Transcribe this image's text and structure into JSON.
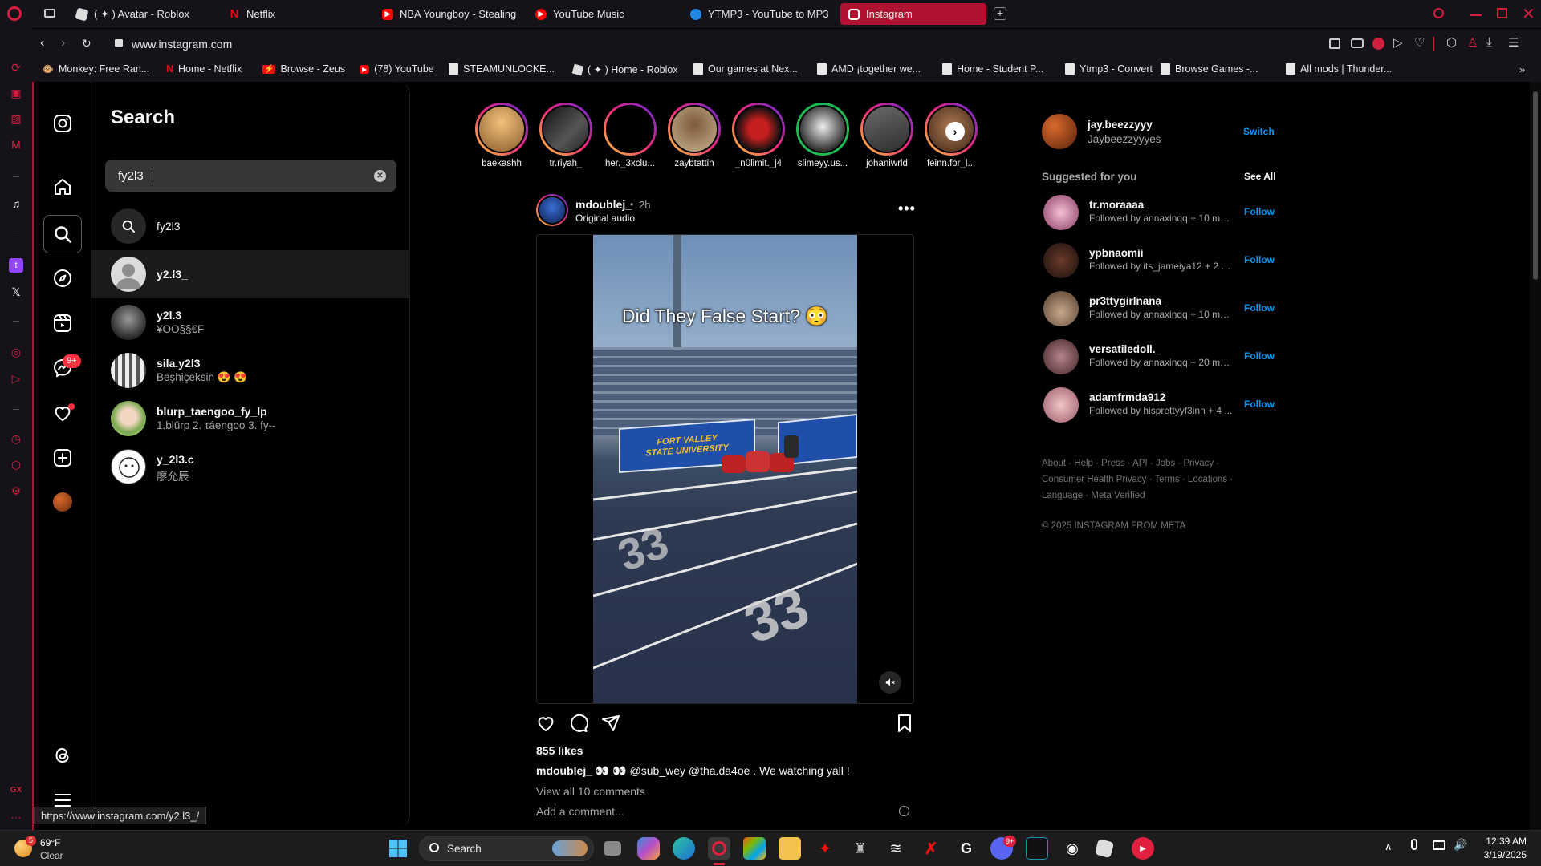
{
  "browser": {
    "tabs": [
      {
        "label": "( ✦ ) Avatar - Roblox",
        "favicon": "roblox-icon"
      },
      {
        "label": "Netflix",
        "favicon": "netflix-icon"
      },
      {
        "label": "NBA Youngboy - Stealing",
        "favicon": "youtube-icon"
      },
      {
        "label": "YouTube Music",
        "favicon": "youtube-music-icon"
      },
      {
        "label": "YTMP3 - YouTube to MP3",
        "favicon": "ytmp3-icon"
      },
      {
        "label": "Instagram",
        "favicon": "instagram-icon",
        "active": true
      }
    ],
    "url": "www.instagram.com",
    "bookmarks": [
      "Monkey: Free Ran...",
      "Home - Netflix",
      "Browse - Zeus",
      "(78) YouTube",
      "STEAMUNLOCKE...",
      "( ✦ ) Home - Roblox",
      "Our games at Nex...",
      "AMD ¡together we...",
      "Home - Student P...",
      "Ytmp3 - Convert",
      "Browse Games -...",
      "All mods | Thunder..."
    ],
    "status_url": "https://www.instagram.com/y2.l3_/",
    "accent": "#b01231"
  },
  "search_panel": {
    "title": "Search",
    "query": "fy2l3",
    "results": [
      {
        "type": "query",
        "title": "fy2l3",
        "subtitle": ""
      },
      {
        "type": "user",
        "title": "y2.l3_",
        "subtitle": ""
      },
      {
        "type": "user",
        "title": "y2l.3",
        "subtitle": "¥OO§§€F"
      },
      {
        "type": "user",
        "title": "sila.y2l3",
        "subtitle": "Beşhiçeksin 😍 😍"
      },
      {
        "type": "user",
        "title": "blurp_taengoo_fy_lp",
        "subtitle": "1.blürp 2. τáengoo 3. fy--"
      },
      {
        "type": "user",
        "title": "y_2l3.c",
        "subtitle": "廖允辰"
      }
    ]
  },
  "nav": {
    "messages_badge": "9+"
  },
  "stories": [
    "baekashh",
    "tr.riyah_",
    "her._3xclu...",
    "zaybtattin",
    "_n0limit._j4",
    "slimeyy.us...",
    "johaniwrld",
    "feinn.for_l..."
  ],
  "post": {
    "username": "mdoublej_",
    "time": "2h",
    "sep": "•",
    "audio": "Original audio",
    "video_caption": "Did They False Start? 😳",
    "banner_text": "FORT VALLEY STATE UNIVERSITY",
    "likes": "855 likes",
    "caption_user": "mdoublej_",
    "caption_text": "👀 👀 @sub_wey @tha.da4oe . We watching yall !",
    "view_comments": "View all 10 comments",
    "add_comment": "Add a comment..."
  },
  "right": {
    "me_username": "jay.beezzyyy",
    "me_name": "Jaybeezzyyyes",
    "switch": "Switch",
    "suggested_title": "Suggested for you",
    "see_all": "See All",
    "follow": "Follow",
    "suggestions": [
      {
        "username": "tr.moraaaa",
        "sub": "Followed by annaxinqq + 10 more"
      },
      {
        "username": "ypbnaomii",
        "sub": "Followed by its_jameiya12 + 2 m..."
      },
      {
        "username": "pr3ttygirlnana_",
        "sub": "Followed by annaxinqq + 10 more"
      },
      {
        "username": "versatiledoll._",
        "sub": "Followed by annaxinqq + 20 more"
      },
      {
        "username": "adamfrmda912",
        "sub": "Followed by hisprettyyf3inn + 4 ..."
      }
    ],
    "footer1": "About · Help · Press · API · Jobs · Privacy ·",
    "footer2": "Consumer Health Privacy · Terms · Locations ·",
    "footer3": "Language · Meta Verified",
    "copyright": "© 2025 INSTAGRAM FROM META"
  },
  "taskbar": {
    "weather_temp": "69°F",
    "weather_desc": "Clear",
    "weather_badge": "5",
    "search": "Search",
    "time": "12:39 AM",
    "date": "3/19/2025",
    "discord_badge": "9+"
  }
}
